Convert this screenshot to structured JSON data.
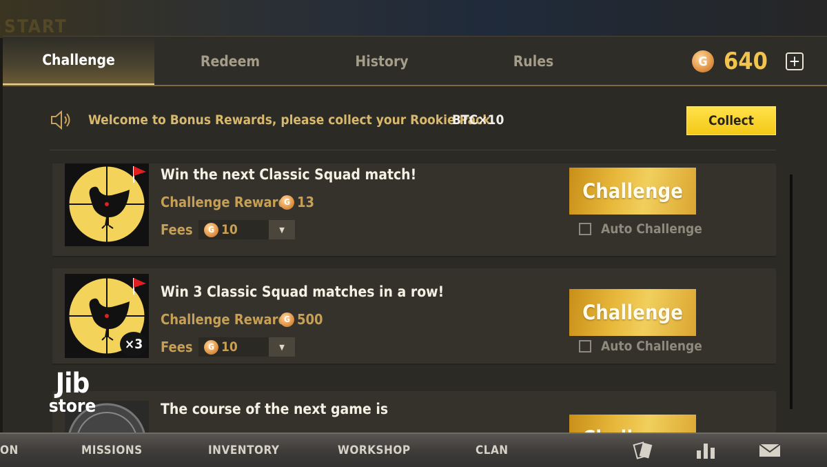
{
  "tabs": [
    {
      "label": "Challenge",
      "active": true
    },
    {
      "label": "Redeem",
      "active": false
    },
    {
      "label": "History",
      "active": false
    },
    {
      "label": "Rules",
      "active": false
    }
  ],
  "currency": {
    "icon": "g-coin-icon",
    "balance": "640",
    "coin_glyph": "G"
  },
  "notice": {
    "icon": "speaker-icon",
    "text": "Welcome to Bonus Rewards, please collect your Rookie Pack.",
    "reward": "BTC×10",
    "button": "Collect"
  },
  "challenges": [
    {
      "title": "Win the next Classic Squad match!",
      "reward_label": "Challenge Reward",
      "reward_value": "13",
      "fees_label": "Fees",
      "fees_value": "10",
      "button": "Challenge",
      "auto_label": "Auto Challenge",
      "auto_checked": false,
      "image": "chicken-crosshair-icon"
    },
    {
      "title": "Win 3 Classic Squad matches in a row!",
      "reward_label": "Challenge Reward",
      "reward_value": "500",
      "fees_label": "Fees",
      "fees_value": "10",
      "button": "Challenge",
      "auto_label": "Auto Challenge",
      "auto_checked": false,
      "image": "chicken-crosshair-icon",
      "multiplier": "×3"
    },
    {
      "title": "The course of the next game is",
      "button": "Challenge",
      "image": "compass-icon"
    }
  ],
  "bottom_nav": {
    "items": [
      "ON",
      "MISSIONS",
      "INVENTORY",
      "WORKSHOP",
      "CLAN"
    ],
    "icons": [
      "cards-icon",
      "bar-chart-icon",
      "mail-icon"
    ]
  },
  "background": {
    "start_text": "START"
  },
  "watermark": {
    "line1": "Jib",
    "line2": "store"
  },
  "colors": {
    "accent_gold": "#f3c44d",
    "button_yellow": "#f4c817",
    "reward_text": "#c79f55"
  }
}
